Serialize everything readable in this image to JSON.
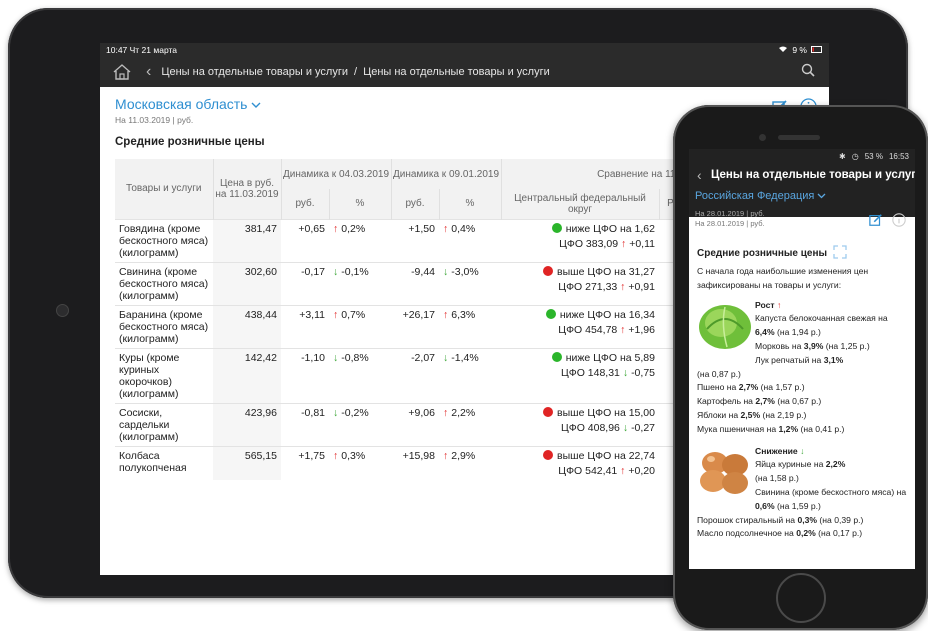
{
  "tablet": {
    "status": {
      "time_day": "10:47  Чт 21 марта",
      "battery": "9 %"
    },
    "nav": {
      "crumb1": "Цены на отдельные товары и услуги",
      "sep": "/",
      "crumb2": "Цены на отдельные товары и услуги"
    },
    "region": "Московская область",
    "date": "На 11.03.2019 | руб.",
    "title": "Средние розничные цены",
    "headers": {
      "goods": "Товары и услуги",
      "price": "Цена в руб. на 11.03.2019",
      "dyn1": "Динамика к 04.03.2019",
      "dyn2": "Динамика к 09.01.2019",
      "rub": "руб.",
      "pct": "%",
      "cmp": "Сравнение на 11",
      "cfo": "Центральный федеральный округ",
      "next": "Р"
    },
    "rows": [
      {
        "name": "Говядина (кроме бескостного мяса) (килограмм)",
        "price": "381,47",
        "d1r": "+0,65",
        "d1p": "0,2%",
        "d1dir": "up",
        "d2r": "+1,50",
        "d2p": "0,4%",
        "d2dir": "up",
        "dot": "#2bb52b",
        "cmp1": "ниже ЦФО на 1,62",
        "cmp2": "ЦФО 383,09",
        "cdir": "up",
        "cval": "+0,11"
      },
      {
        "name": "Свинина (кроме бескостного мяса) (килограмм)",
        "price": "302,60",
        "d1r": "-0,17",
        "d1p": "-0,1%",
        "d1dir": "down",
        "d2r": "-9,44",
        "d2p": "-3,0%",
        "d2dir": "down",
        "dot": "#e02424",
        "cmp1": "выше ЦФО на 31,27",
        "cmp2": "ЦФО 271,33",
        "cdir": "up",
        "cval": "+0,91"
      },
      {
        "name": "Баранина (кроме бескостного мяса) (килограмм)",
        "price": "438,44",
        "d1r": "+3,11",
        "d1p": "0,7%",
        "d1dir": "up",
        "d2r": "+26,17",
        "d2p": "6,3%",
        "d2dir": "up",
        "dot": "#2bb52b",
        "cmp1": "ниже ЦФО на 16,34",
        "cmp2": "ЦФО 454,78",
        "cdir": "up",
        "cval": "+1,96"
      },
      {
        "name": "Куры (кроме куриных окорочков) (килограмм)",
        "price": "142,42",
        "d1r": "-1,10",
        "d1p": "-0,8%",
        "d1dir": "down",
        "d2r": "-2,07",
        "d2p": "-1,4%",
        "d2dir": "down",
        "dot": "#2bb52b",
        "cmp1": "ниже ЦФО на 5,89",
        "cmp2": "ЦФО 148,31",
        "cdir": "down",
        "cval": "-0,75"
      },
      {
        "name": "Сосиски, сардельки (килограмм)",
        "price": "423,96",
        "d1r": "-0,81",
        "d1p": "-0,2%",
        "d1dir": "down",
        "d2r": "+9,06",
        "d2p": "2,2%",
        "d2dir": "up",
        "dot": "#e02424",
        "cmp1": "выше ЦФО на 15,00",
        "cmp2": "ЦФО 408,96",
        "cdir": "down",
        "cval": "-0,27"
      },
      {
        "name": "Колбаса полукопченая",
        "price": "565,15",
        "d1r": "+1,75",
        "d1p": "0,3%",
        "d1dir": "up",
        "d2r": "+15,98",
        "d2p": "2,9%",
        "d2dir": "up",
        "dot": "#e02424",
        "cmp1": "выше ЦФО на 22,74",
        "cmp2": "ЦФО 542,41",
        "cdir": "up",
        "cval": "+0,20"
      }
    ]
  },
  "phone": {
    "status": {
      "battery": "53 %",
      "time": "16:53"
    },
    "title": "Цены на отдельные товары и услуги",
    "region": "Российская Федерация",
    "date": "На 28.01.2019 | руб.",
    "heading": "Средние розничные цены",
    "intro": "С начала года наибольшие изменения цен зафиксированы на товары и услуги:",
    "growth_label": "Рост",
    "decline_label": "Снижение"
  },
  "colors": {
    "accent": "#2f8fd1",
    "up": "#e02424",
    "down": "#3aa535",
    "bar": "#2b2b2b"
  }
}
